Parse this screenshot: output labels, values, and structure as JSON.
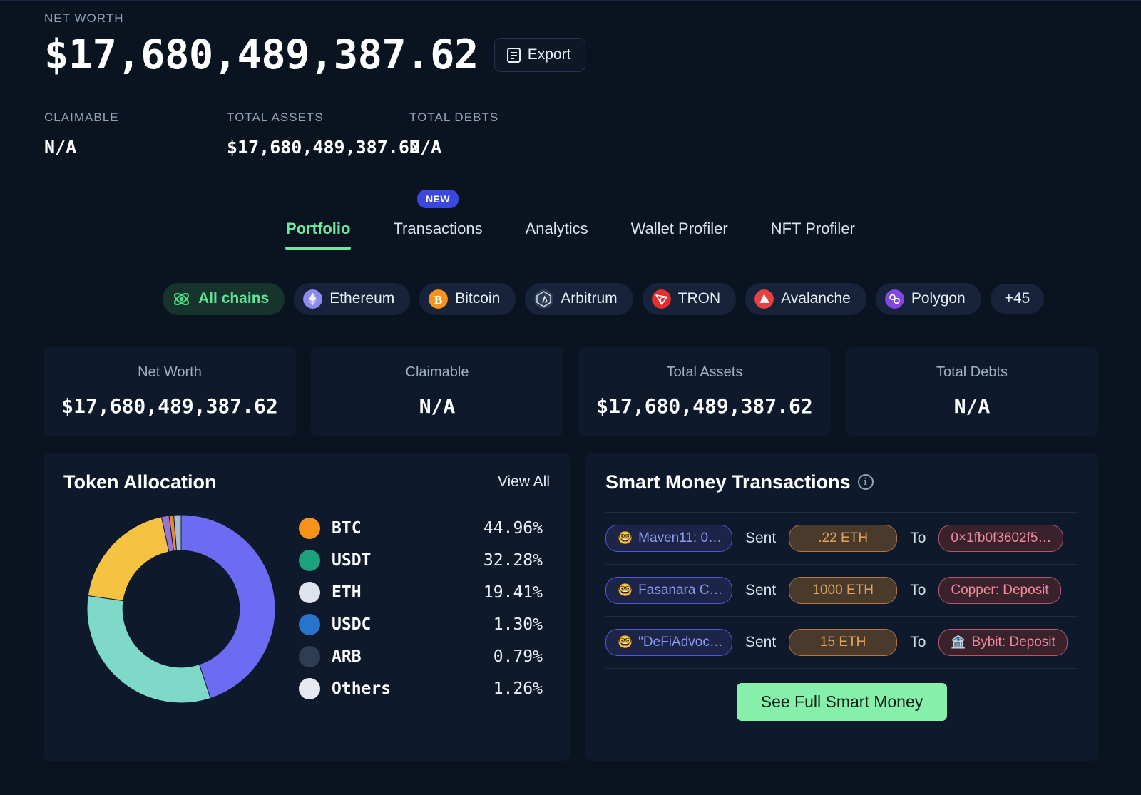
{
  "header": {
    "net_worth_label": "NET WORTH",
    "net_worth_value": "$17,680,489,387.62",
    "export_label": "Export",
    "substats": [
      {
        "label": "CLAIMABLE",
        "value": "N/A"
      },
      {
        "label": "TOTAL ASSETS",
        "value": "$17,680,489,387.62"
      },
      {
        "label": "TOTAL DEBTS",
        "value": "N/A"
      }
    ]
  },
  "tabs": [
    {
      "label": "Portfolio",
      "active": true,
      "badge": ""
    },
    {
      "label": "Transactions",
      "active": false,
      "badge": "NEW"
    },
    {
      "label": "Analytics",
      "active": false,
      "badge": ""
    },
    {
      "label": "Wallet Profiler",
      "active": false,
      "badge": ""
    },
    {
      "label": "NFT Profiler",
      "active": false,
      "badge": ""
    }
  ],
  "chains": [
    {
      "label": "All chains",
      "active": true,
      "color": "#4ade80",
      "icon": "all-chains-icon"
    },
    {
      "label": "Ethereum",
      "active": false,
      "color": "#8c8cf0",
      "icon": "ethereum-icon"
    },
    {
      "label": "Bitcoin",
      "active": false,
      "color": "#f7931a",
      "icon": "bitcoin-icon"
    },
    {
      "label": "Arbitrum",
      "active": false,
      "color": "#2d3e54",
      "icon": "arbitrum-icon"
    },
    {
      "label": "TRON",
      "active": false,
      "color": "#eb2c2c",
      "icon": "tron-icon"
    },
    {
      "label": "Avalanche",
      "active": false,
      "color": "#e84142",
      "icon": "avalanche-icon"
    },
    {
      "label": "Polygon",
      "active": false,
      "color": "#8247e5",
      "icon": "polygon-icon"
    },
    {
      "label": "+45",
      "active": false,
      "color": "",
      "icon": ""
    }
  ],
  "stat_cards": [
    {
      "title": "Net Worth",
      "value": "$17,680,489,387.62"
    },
    {
      "title": "Claimable",
      "value": "N/A"
    },
    {
      "title": "Total Assets",
      "value": "$17,680,489,387.62"
    },
    {
      "title": "Total Debts",
      "value": "N/A"
    }
  ],
  "token_allocation": {
    "title": "Token Allocation",
    "view_all": "View All"
  },
  "chart_data": {
    "type": "pie",
    "title": "Token Allocation",
    "legend_position": "right",
    "categories": [
      "BTC",
      "USDT",
      "ETH",
      "USDC",
      "ARB",
      "Others"
    ],
    "values": [
      44.96,
      32.28,
      19.41,
      1.3,
      0.79,
      1.26
    ],
    "labels": [
      "44.96%",
      "32.28%",
      "19.41%",
      "1.30%",
      "0.79%",
      "1.26%"
    ],
    "colors": [
      "#6c6cf2",
      "#7fd9c8",
      "#f5c242",
      "#9a74d4",
      "#e08a3c",
      "#a9bdd4"
    ],
    "icon_colors": [
      "#f7931a",
      "#1ba27a",
      "#dfe3ee",
      "#2775ca",
      "#2d3e54",
      "#e6e9ef"
    ],
    "donut": true,
    "inner_radius_pct": 62,
    "start_angle": 0
  },
  "smart_money": {
    "title": "Smart Money Transactions",
    "info_icon": "info-icon",
    "verb": "Sent",
    "preposition": "To",
    "rows": [
      {
        "from": "Maven11: 0…",
        "from_emoji": "🤓",
        "amount": ".22 ETH",
        "to": "0×1fb0f3602f5…",
        "to_emoji": ""
      },
      {
        "from": "Fasanara C…",
        "from_emoji": "🤓",
        "amount": "1000 ETH",
        "to": "Copper: Deposit",
        "to_emoji": ""
      },
      {
        "from": "\"DeFiAdvoc…",
        "from_emoji": "🤓",
        "amount": "15 ETH",
        "to": "Bybit: Deposit",
        "to_emoji": "🏦"
      }
    ],
    "button_label": "See Full Smart Money"
  }
}
